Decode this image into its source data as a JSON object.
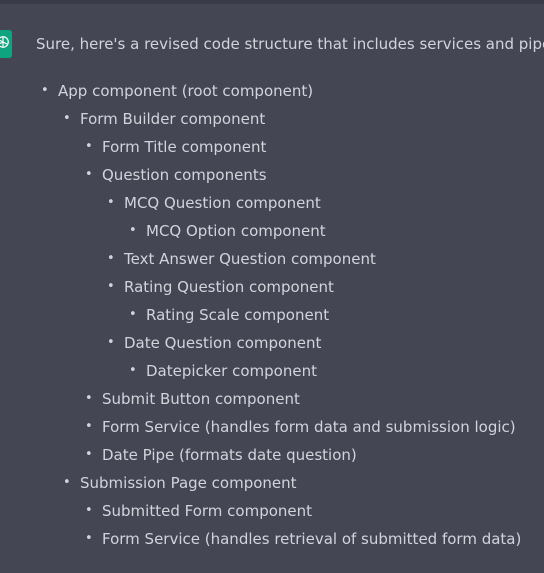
{
  "message": {
    "intro": "Sure, here's a revised code structure that includes services and pipes:",
    "avatar_icon": "openai-logo-icon",
    "accent_color": "#10a37f",
    "items": [
      {
        "level": 0,
        "label": "App component (root component)"
      },
      {
        "level": 1,
        "label": "Form Builder component"
      },
      {
        "level": 2,
        "label": "Form Title component"
      },
      {
        "level": 2,
        "label": "Question components"
      },
      {
        "level": 3,
        "label": "MCQ Question component"
      },
      {
        "level": 4,
        "label": "MCQ Option component"
      },
      {
        "level": 3,
        "label": "Text Answer Question component"
      },
      {
        "level": 3,
        "label": "Rating Question component"
      },
      {
        "level": 4,
        "label": "Rating Scale component"
      },
      {
        "level": 3,
        "label": "Date Question component"
      },
      {
        "level": 4,
        "label": "Datepicker component"
      },
      {
        "level": 2,
        "label": "Submit Button component"
      },
      {
        "level": 2,
        "label": "Form Service (handles form data and submission logic)"
      },
      {
        "level": 2,
        "label": "Date Pipe (formats date question)"
      },
      {
        "level": 1,
        "label": "Submission Page component"
      },
      {
        "level": 2,
        "label": "Submitted Form component"
      },
      {
        "level": 2,
        "label": "Form Service (handles retrieval of submitted form data)"
      }
    ]
  }
}
